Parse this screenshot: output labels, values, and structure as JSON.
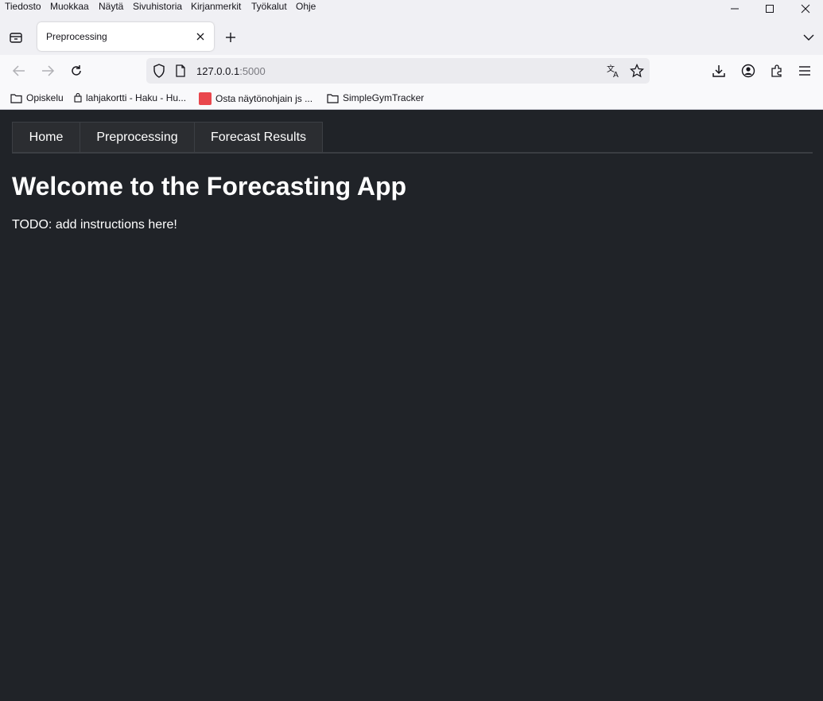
{
  "browser": {
    "menu": [
      "Tiedosto",
      "Muokkaa",
      "Näytä",
      "Sivuhistoria",
      "Kirjanmerkit",
      "Työkalut",
      "Ohje"
    ],
    "tab_title": "Preprocessing",
    "url_host": "127.0.0.1",
    "url_port": ":5000",
    "bookmarks": [
      {
        "label": "Opiskelu",
        "icon": "folder-icon"
      },
      {
        "label": "lahjakortti - Haku - Hu...",
        "icon": "bag-icon"
      },
      {
        "label": "Osta näytönohjain js ...",
        "icon": "tori-favicon"
      },
      {
        "label": "SimpleGymTracker",
        "icon": "folder-icon"
      }
    ]
  },
  "page": {
    "nav": [
      "Home",
      "Preprocessing",
      "Forecast Results"
    ],
    "heading": "Welcome to the Forecasting App",
    "intro": "TODO: add instructions here!"
  },
  "colors": {
    "page_bg": "#202328",
    "nav_tab_bg": "#2b2d31",
    "text": "#ffffff"
  }
}
